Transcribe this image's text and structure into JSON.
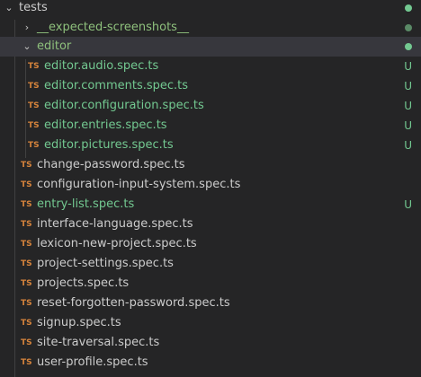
{
  "explorer": {
    "root_folder": {
      "label": "tests",
      "expanded": true,
      "decoration": "modified-dot"
    },
    "folders": [
      {
        "label": "__expected-screenshots__",
        "expanded": false,
        "decoration": "modified-dot"
      },
      {
        "label": "editor",
        "expanded": true,
        "decoration": "modified-dot"
      }
    ],
    "editor_files": [
      {
        "icon": "TS",
        "label": "editor.audio.spec.ts",
        "status": "U"
      },
      {
        "icon": "TS",
        "label": "editor.comments.spec.ts",
        "status": "U"
      },
      {
        "icon": "TS",
        "label": "editor.configuration.spec.ts",
        "status": "U"
      },
      {
        "icon": "TS",
        "label": "editor.entries.spec.ts",
        "status": "U"
      },
      {
        "icon": "TS",
        "label": "editor.pictures.spec.ts",
        "status": "U"
      }
    ],
    "test_files": [
      {
        "icon": "TS",
        "label": "change-password.spec.ts",
        "status": ""
      },
      {
        "icon": "TS",
        "label": "configuration-input-system.spec.ts",
        "status": ""
      },
      {
        "icon": "TS",
        "label": "entry-list.spec.ts",
        "status": "U"
      },
      {
        "icon": "TS",
        "label": "interface-language.spec.ts",
        "status": ""
      },
      {
        "icon": "TS",
        "label": "lexicon-new-project.spec.ts",
        "status": ""
      },
      {
        "icon": "TS",
        "label": "project-settings.spec.ts",
        "status": ""
      },
      {
        "icon": "TS",
        "label": "projects.spec.ts",
        "status": ""
      },
      {
        "icon": "TS",
        "label": "reset-forgotten-password.spec.ts",
        "status": ""
      },
      {
        "icon": "TS",
        "label": "signup.spec.ts",
        "status": ""
      },
      {
        "icon": "TS",
        "label": "site-traversal.spec.ts",
        "status": ""
      },
      {
        "icon": "TS",
        "label": "user-profile.spec.ts",
        "status": ""
      }
    ],
    "colors": {
      "background": "#252526",
      "selected_row": "#37373d",
      "untracked_green": "#73c991",
      "ts_icon_orange": "#d6843c",
      "default_text": "#cccccc"
    }
  }
}
